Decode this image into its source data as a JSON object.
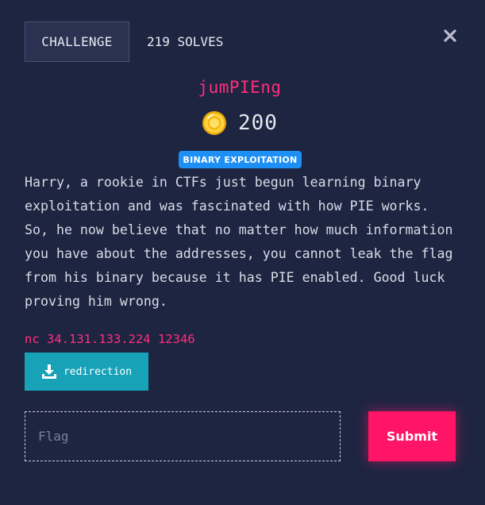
{
  "tabs": {
    "challenge_label": "CHALLENGE",
    "solves_label": "219 SOLVES"
  },
  "close_icon": "close-icon",
  "challenge": {
    "title": "jumPIEng",
    "points": "200",
    "coin_icon": "coin-icon",
    "category": "BINARY EXPLOITATION",
    "description": "Harry, a rookie in CTFs just begun learning binary\nexploitation and was fascinated with how PIE works.\nSo, he now believe that no matter how much information\nyou have about the addresses, you cannot leak the flag\nfrom his binary because it has PIE enabled. Good luck\nproving him wrong.",
    "connection": "nc 34.131.133.224 12346",
    "file": {
      "label": "redirection",
      "icon": "download-icon"
    }
  },
  "form": {
    "flag_placeholder": "Flag",
    "flag_value": "",
    "submit_label": "Submit"
  },
  "colors": {
    "background": "#1e2541",
    "title": "#ff2e7e",
    "badge": "#1e8ff5",
    "download": "#17a2b8",
    "submit": "#ff1466"
  }
}
